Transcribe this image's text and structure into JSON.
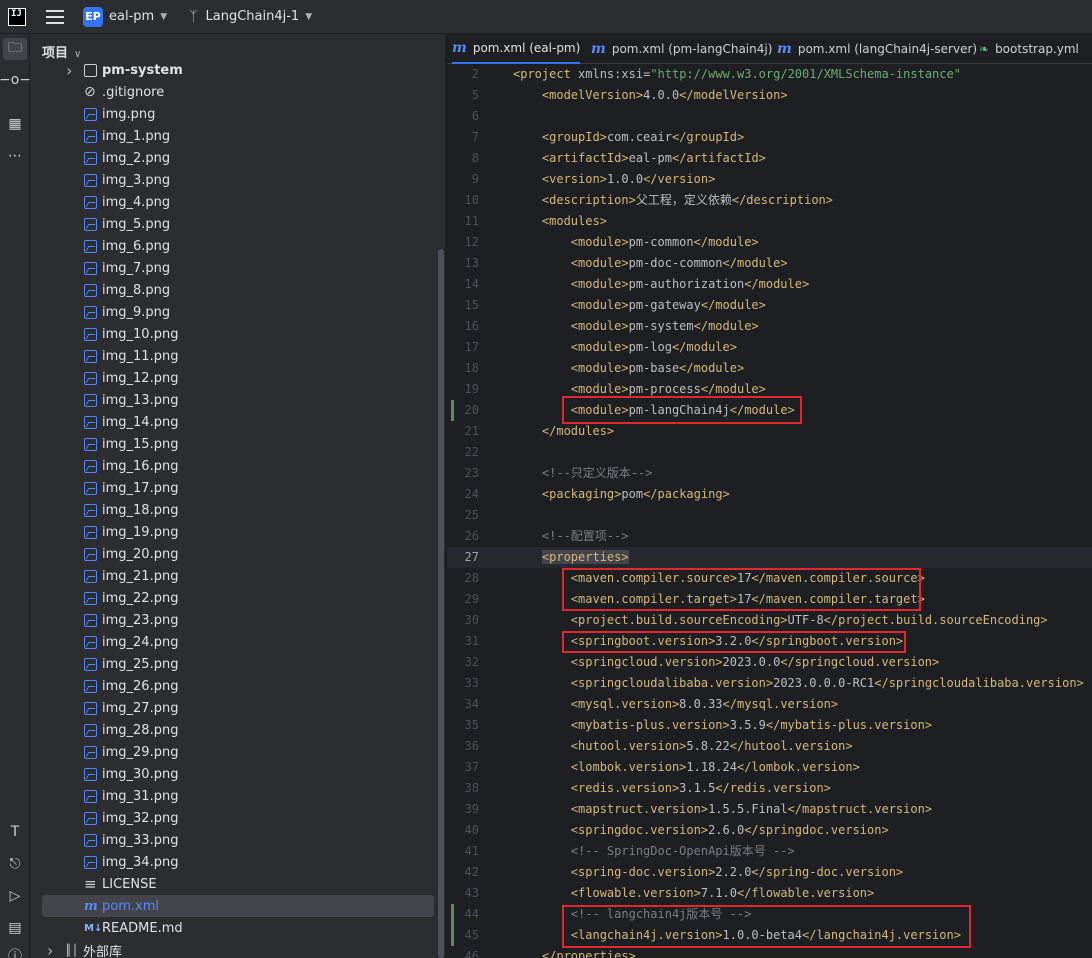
{
  "topbar": {
    "app_logo": "IJ",
    "project_badge": "EP",
    "project_name": "eal-pm",
    "branch_name": "LangChain4j-1"
  },
  "project_panel": {
    "title": "项目",
    "tree": [
      {
        "name": "pm-system",
        "type": "folder",
        "bold": true
      },
      {
        "name": ".gitignore",
        "type": "ignore"
      },
      {
        "name": "img.png",
        "type": "image"
      },
      {
        "name": "img_1.png",
        "type": "image"
      },
      {
        "name": "img_2.png",
        "type": "image"
      },
      {
        "name": "img_3.png",
        "type": "image"
      },
      {
        "name": "img_4.png",
        "type": "image"
      },
      {
        "name": "img_5.png",
        "type": "image"
      },
      {
        "name": "img_6.png",
        "type": "image"
      },
      {
        "name": "img_7.png",
        "type": "image"
      },
      {
        "name": "img_8.png",
        "type": "image"
      },
      {
        "name": "img_9.png",
        "type": "image"
      },
      {
        "name": "img_10.png",
        "type": "image"
      },
      {
        "name": "img_11.png",
        "type": "image"
      },
      {
        "name": "img_12.png",
        "type": "image"
      },
      {
        "name": "img_13.png",
        "type": "image"
      },
      {
        "name": "img_14.png",
        "type": "image"
      },
      {
        "name": "img_15.png",
        "type": "image"
      },
      {
        "name": "img_16.png",
        "type": "image"
      },
      {
        "name": "img_17.png",
        "type": "image"
      },
      {
        "name": "img_18.png",
        "type": "image"
      },
      {
        "name": "img_19.png",
        "type": "image"
      },
      {
        "name": "img_20.png",
        "type": "image"
      },
      {
        "name": "img_21.png",
        "type": "image"
      },
      {
        "name": "img_22.png",
        "type": "image"
      },
      {
        "name": "img_23.png",
        "type": "image"
      },
      {
        "name": "img_24.png",
        "type": "image"
      },
      {
        "name": "img_25.png",
        "type": "image"
      },
      {
        "name": "img_26.png",
        "type": "image"
      },
      {
        "name": "img_27.png",
        "type": "image"
      },
      {
        "name": "img_28.png",
        "type": "image"
      },
      {
        "name": "img_29.png",
        "type": "image"
      },
      {
        "name": "img_30.png",
        "type": "image"
      },
      {
        "name": "img_31.png",
        "type": "image"
      },
      {
        "name": "img_32.png",
        "type": "image"
      },
      {
        "name": "img_33.png",
        "type": "image"
      },
      {
        "name": "img_34.png",
        "type": "image"
      },
      {
        "name": "LICENSE",
        "type": "text"
      },
      {
        "name": "pom.xml",
        "type": "maven",
        "selected": true
      },
      {
        "name": "README.md",
        "type": "markdown"
      },
      {
        "name": "外部库",
        "type": "library"
      }
    ]
  },
  "tabs": [
    {
      "label": "pom.xml (eal-pm)",
      "icon": "maven-icon",
      "active": true
    },
    {
      "label": "pom.xml (pm-langChain4j)",
      "icon": "maven-icon"
    },
    {
      "label": "pom.xml (langChain4j-server)",
      "icon": "maven-icon"
    },
    {
      "label": "bootstrap.yml",
      "icon": "leaf-icon"
    }
  ],
  "code_lines": [
    {
      "n": "2",
      "html": "<span class='tag'>&lt;project </span><span class='attr'>xmlns:xsi</span><span class='txt'>=</span><span class='str'>\"http://www.w3.org/2001/XMLSchema-instance\"</span>"
    },
    {
      "n": "5",
      "html": "    <span class='tag'>&lt;modelVersion&gt;</span><span class='txt'>4.0.0</span><span class='tag'>&lt;/modelVersion&gt;</span>"
    },
    {
      "n": "6",
      "html": ""
    },
    {
      "n": "7",
      "html": "    <span class='tag'>&lt;groupId&gt;</span><span class='txt'>com.ceair</span><span class='tag'>&lt;/groupId&gt;</span>"
    },
    {
      "n": "8",
      "html": "    <span class='tag'>&lt;artifactId&gt;</span><span class='txt'>eal-pm</span><span class='tag'>&lt;/artifactId&gt;</span>"
    },
    {
      "n": "9",
      "html": "    <span class='tag'>&lt;version&gt;</span><span class='txt'>1.0.0</span><span class='tag'>&lt;/version&gt;</span>"
    },
    {
      "n": "10",
      "html": "    <span class='tag'>&lt;description&gt;</span><span class='txt'>父工程，定义依赖</span><span class='tag'>&lt;/description&gt;</span>"
    },
    {
      "n": "11",
      "html": "    <span class='tag'>&lt;modules&gt;</span>"
    },
    {
      "n": "12",
      "html": "        <span class='tag'>&lt;module&gt;</span><span class='txt'>pm-common</span><span class='tag'>&lt;/module&gt;</span>"
    },
    {
      "n": "13",
      "html": "        <span class='tag'>&lt;module&gt;</span><span class='txt'>pm-doc-common</span><span class='tag'>&lt;/module&gt;</span>"
    },
    {
      "n": "14",
      "html": "        <span class='tag'>&lt;module&gt;</span><span class='txt'>pm-authorization</span><span class='tag'>&lt;/module&gt;</span>"
    },
    {
      "n": "15",
      "html": "        <span class='tag'>&lt;module&gt;</span><span class='txt'>pm-gateway</span><span class='tag'>&lt;/module&gt;</span>"
    },
    {
      "n": "16",
      "html": "        <span class='tag'>&lt;module&gt;</span><span class='txt'>pm-system</span><span class='tag'>&lt;/module&gt;</span>"
    },
    {
      "n": "17",
      "html": "        <span class='tag'>&lt;module&gt;</span><span class='txt'>pm-log</span><span class='tag'>&lt;/module&gt;</span>"
    },
    {
      "n": "18",
      "html": "        <span class='tag'>&lt;module&gt;</span><span class='txt'>pm-base</span><span class='tag'>&lt;/module&gt;</span>"
    },
    {
      "n": "19",
      "html": "        <span class='tag'>&lt;module&gt;</span><span class='txt'>pm-process</span><span class='tag'>&lt;/module&gt;</span>"
    },
    {
      "n": "20",
      "html": "        <span class='tag'>&lt;module&gt;</span><span class='txt'>pm-langChain4j</span><span class='tag'>&lt;/module&gt;</span>",
      "changed": true
    },
    {
      "n": "21",
      "html": "    <span class='tag'>&lt;/modules&gt;</span>"
    },
    {
      "n": "22",
      "html": ""
    },
    {
      "n": "23",
      "html": "    <span class='cmt'>&lt;!--只定义版本--&gt;</span>"
    },
    {
      "n": "24",
      "html": "    <span class='tag'>&lt;packaging&gt;</span><span class='txt'>pom</span><span class='tag'>&lt;/packaging&gt;</span>"
    },
    {
      "n": "25",
      "html": ""
    },
    {
      "n": "26",
      "html": "    <span class='cmt'>&lt;!--配置项--&gt;</span>"
    },
    {
      "n": "27",
      "html": "    <span class='tag hl-tag'>&lt;properties&gt;</span>",
      "current": true
    },
    {
      "n": "28",
      "html": "        <span class='tag'>&lt;maven.compiler.source&gt;</span><span class='txt'>17</span><span class='tag'>&lt;/maven.compiler.source&gt;</span>"
    },
    {
      "n": "29",
      "html": "        <span class='tag'>&lt;maven.compiler.target&gt;</span><span class='txt'>17</span><span class='tag'>&lt;/maven.compiler.target&gt;</span>"
    },
    {
      "n": "30",
      "html": "        <span class='tag'>&lt;project.build.sourceEncoding&gt;</span><span class='txt'>UTF-8</span><span class='tag'>&lt;/project.build.sourceEncoding&gt;</span>"
    },
    {
      "n": "31",
      "html": "        <span class='tag'>&lt;springboot.version&gt;</span><span class='txt'>3.2.0</span><span class='tag'>&lt;/springboot.version&gt;</span>"
    },
    {
      "n": "32",
      "html": "        <span class='tag'>&lt;springcloud.version&gt;</span><span class='txt'>2023.0.0</span><span class='tag'>&lt;/springcloud.version&gt;</span>"
    },
    {
      "n": "33",
      "html": "        <span class='tag'>&lt;springcloudalibaba.version&gt;</span><span class='txt'>2023.0.0.0-RC1</span><span class='tag'>&lt;/springcloudalibaba.version&gt;</span>"
    },
    {
      "n": "34",
      "html": "        <span class='tag'>&lt;mysql.version&gt;</span><span class='txt'>8.0.33</span><span class='tag'>&lt;/mysql.version&gt;</span>"
    },
    {
      "n": "35",
      "html": "        <span class='tag'>&lt;mybatis-plus.version&gt;</span><span class='txt'>3.5.9</span><span class='tag'>&lt;/mybatis-plus.version&gt;</span>"
    },
    {
      "n": "36",
      "html": "        <span class='tag'>&lt;hutool.version&gt;</span><span class='txt'>5.8.22</span><span class='tag'>&lt;/hutool.version&gt;</span>"
    },
    {
      "n": "37",
      "html": "        <span class='tag'>&lt;lombok.version&gt;</span><span class='txt'>1.18.24</span><span class='tag'>&lt;/lombok.version&gt;</span>"
    },
    {
      "n": "38",
      "html": "        <span class='tag'>&lt;redis.version&gt;</span><span class='txt'>3.1.5</span><span class='tag'>&lt;/redis.version&gt;</span>"
    },
    {
      "n": "39",
      "html": "        <span class='tag'>&lt;mapstruct.version&gt;</span><span class='txt'>1.5.5.Final</span><span class='tag'>&lt;/mapstruct.version&gt;</span>"
    },
    {
      "n": "40",
      "html": "        <span class='tag'>&lt;springdoc.version&gt;</span><span class='txt'>2.6.0</span><span class='tag'>&lt;/springdoc.version&gt;</span>"
    },
    {
      "n": "41",
      "html": "        <span class='cmt'>&lt;!-- SpringDoc-OpenApi版本号 --&gt;</span>"
    },
    {
      "n": "42",
      "html": "        <span class='tag'>&lt;spring-doc.version&gt;</span><span class='txt'>2.2.0</span><span class='tag'>&lt;/spring-doc.version&gt;</span>"
    },
    {
      "n": "43",
      "html": "        <span class='tag'>&lt;flowable.version&gt;</span><span class='txt'>7.1.0</span><span class='tag'>&lt;/flowable.version&gt;</span>"
    },
    {
      "n": "44",
      "html": "        <span class='cmt'>&lt;!-- langchain4j版本号 --&gt;</span>",
      "changed": true
    },
    {
      "n": "45",
      "html": "        <span class='tag'>&lt;langchain4j.version&gt;</span><span class='txt'>1.0.0-beta4</span><span class='tag'>&lt;/langchain4j.version&gt;</span>",
      "changed": true
    },
    {
      "n": "46",
      "html": "    <span class='tag'>&lt;/properties&gt;</span>"
    }
  ]
}
